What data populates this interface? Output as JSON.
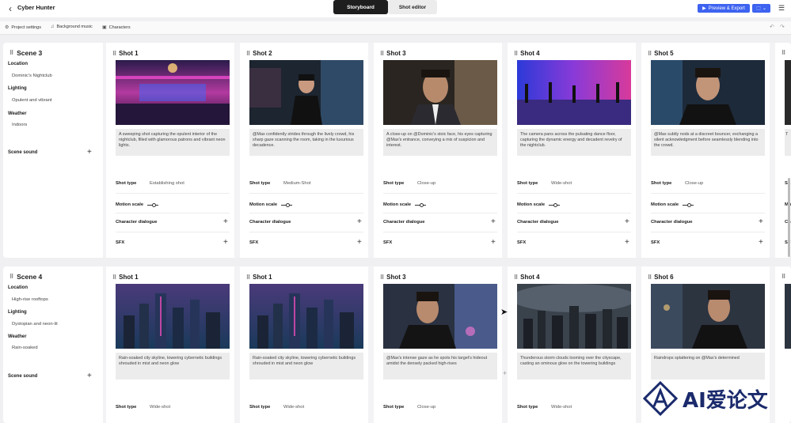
{
  "app": {
    "title": "Cyber Hunter"
  },
  "mode_tabs": [
    {
      "label": "Storyboard",
      "active": true
    },
    {
      "label": "Shot editor",
      "active": false
    }
  ],
  "header_actions": {
    "preview_label": "Preview & Export"
  },
  "toolbar": {
    "items": [
      {
        "icon": "gear-icon",
        "label": "Project settings"
      },
      {
        "icon": "music-icon",
        "label": "Background music"
      },
      {
        "icon": "characters-icon",
        "label": "Characters"
      }
    ]
  },
  "scenes": [
    {
      "title": "Scene 3",
      "location_label": "Location",
      "location": "Dominic's Nightclub",
      "lighting_label": "Lighting",
      "lighting": "Opulent and vibrant",
      "weather_label": "Weather",
      "weather": "Indoors",
      "sound_label": "Scene sound",
      "shots": [
        {
          "title": "Shot 1",
          "description": "A sweeping shot capturing the opulent interior of the nightclub, filled with glamorous patrons and vibrant neon lights.",
          "shot_type": "Establishing shot",
          "image": "nightclub-interior"
        },
        {
          "title": "Shot 2",
          "description": "@Max confidently strides through the lively crowd, his sharp gaze scanning the room, taking in the luxurious decadence.",
          "shot_type": "Medium-Shot",
          "image": "man-leather-jacket"
        },
        {
          "title": "Shot 3",
          "description": "A close-up on @Dominic's stoic face, his eyes capturing @Max's entrance, conveying a mix of suspicion and interest.",
          "shot_type": "Close-up",
          "image": "man-suit-closeup"
        },
        {
          "title": "Shot 4",
          "description": "The camera pans across the pulsating dance floor, capturing the dynamic energy and decadent revelry of the nightclub.",
          "shot_type": "Wide-shot",
          "image": "dance-floor"
        },
        {
          "title": "Shot 5",
          "description": "@Max subtly nods at a discreet bouncer, exchanging a silent acknowledgment before seamlessly blending into the crowd.",
          "shot_type": "Close-up",
          "image": "man-closeup"
        }
      ]
    },
    {
      "title": "Scene 4",
      "location_label": "Location",
      "location": "High-rise rooftops",
      "lighting_label": "Lighting",
      "lighting": "Dystopian and neon-lit",
      "weather_label": "Weather",
      "weather": "Rain-soaked",
      "sound_label": "Scene sound",
      "shots": [
        {
          "title": "Shot 1",
          "description": "Rain-soaked city skyline, towering cybernetic buildings shrouded in mist and neon glow",
          "shot_type": "Wide-shot",
          "image": "city-skyline"
        },
        {
          "title": "Shot 1",
          "description": "Rain-soaked city skyline, towering cybernetic buildings shrouded in mist and neon glow",
          "shot_type": "Wide-shot",
          "image": "city-skyline"
        },
        {
          "title": "Shot 3",
          "description": "@Max's intense gaze as he spots his target's hideout amidst the densely packed high-rises",
          "shot_type": "Close-up",
          "image": "man-rooftop"
        },
        {
          "title": "Shot 4",
          "description": "Thunderous storm clouds looming over the cityscape, casting an ominous glow on the towering buildings",
          "shot_type": "Wide-shot",
          "image": "storm-city"
        },
        {
          "title": "Shot 6",
          "description": "Raindrops splattering on @Max's determined",
          "shot_type": "",
          "image": "man-rain"
        }
      ]
    }
  ],
  "field_labels": {
    "shot_type": "Shot type",
    "motion_scale": "Motion scale",
    "character_dialogue": "Character dialogue",
    "sfx": "SFX"
  },
  "partial_shot": {
    "title_fragment": "S",
    "desc_fragment": "T",
    "label_fragment": "Sh",
    "motion_fragment": "Mo",
    "dialogue_fragment": "Ch",
    "sfx_fragment": "SF"
  },
  "watermark": {
    "text": "AI爱论文"
  }
}
